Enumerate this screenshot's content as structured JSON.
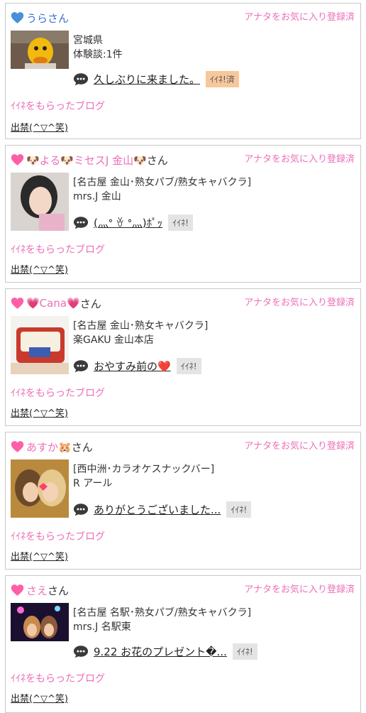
{
  "favorite_label": "アナタをお気に入り登録済",
  "received_label": "ｲｲﾈをもらったブログ",
  "iine_label": "ｲｲﾈ!",
  "iine_done_label": "ｲｲﾈ!済",
  "cards": [
    {
      "heart_color": "#4a90d9",
      "name": "うらさん",
      "suffix": "さん",
      "info1": "宮城県",
      "info2": "体験談:1件",
      "blog_title": "久しぶりに来ました。",
      "shift": "出禁(^▽^笑)"
    },
    {
      "heart_color": "#ff5fa7",
      "name": "🐶よる🐶ミセスJ 金山🐶",
      "suffix": "さん",
      "info1": "[名古屋 金山･熟女パブ/熟女キャバクラ]",
      "info2": "mrs.J 金山",
      "blog_title": "(灬ᐤ ꈊ ᐤ灬)ﾎﾟｯ",
      "shift": "出禁(^▽^笑)"
    },
    {
      "heart_color": "#ff5fa7",
      "name": "💗Cana💗",
      "suffix": "さん",
      "info1": "[名古屋 金山･熟女キャバクラ]",
      "info2": "楽GAKU 金山本店",
      "blog_title": "おやすみ前の❤️",
      "shift": "出禁(^▽^笑)"
    },
    {
      "heart_color": "#ff5fa7",
      "name": "あすか🐹",
      "suffix": "さん",
      "info1": "[西中洲･カラオケスナックバー]",
      "info2": "R アール",
      "blog_title": "ありがとうございました...",
      "shift": "出禁(^▽^笑)"
    },
    {
      "heart_color": "#ff5fa7",
      "name": "さえ",
      "suffix": "さん",
      "info1": "[名古屋 名駅･熟女パブ/熟女キャバクラ]",
      "info2": "mrs.J 名駅東",
      "blog_title": "9.22 お花のプレゼント�...",
      "shift": "出禁(^▽^笑)"
    }
  ]
}
